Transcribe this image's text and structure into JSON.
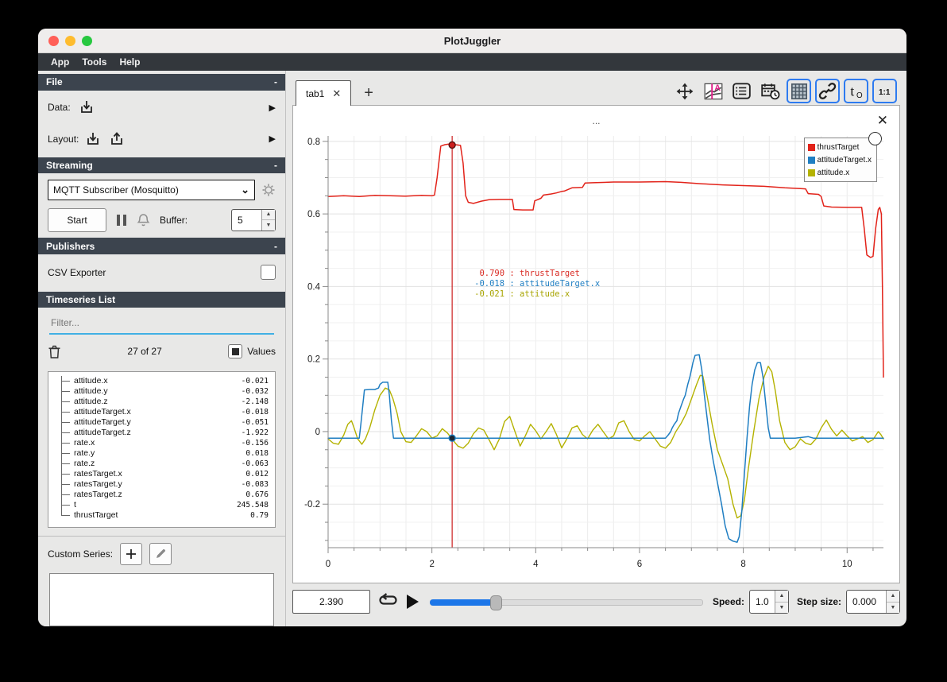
{
  "window": {
    "title": "PlotJuggler"
  },
  "menu": {
    "items": [
      "App",
      "Tools",
      "Help"
    ]
  },
  "sidebar": {
    "file": {
      "header": "File",
      "collapse": "-",
      "data_label": "Data:",
      "layout_label": "Layout:"
    },
    "streaming": {
      "header": "Streaming",
      "collapse": "-",
      "source": "MQTT Subscriber (Mosquitto)",
      "start_label": "Start",
      "buffer_label": "Buffer:",
      "buffer_value": "5"
    },
    "publishers": {
      "header": "Publishers",
      "collapse": "-",
      "csv_exporter_label": "CSV Exporter"
    },
    "timeseries": {
      "header": "Timeseries List",
      "filter_placeholder": "Filter...",
      "count": "27 of 27",
      "values_label": "Values",
      "items": [
        {
          "name": "attitude.x",
          "value": "-0.021"
        },
        {
          "name": "attitude.y",
          "value": "-0.032"
        },
        {
          "name": "attitude.z",
          "value": "-2.148"
        },
        {
          "name": "attitudeTarget.x",
          "value": "-0.018"
        },
        {
          "name": "attitudeTarget.y",
          "value": "-0.051"
        },
        {
          "name": "attitudeTarget.z",
          "value": "-1.922"
        },
        {
          "name": "rate.x",
          "value": "-0.156"
        },
        {
          "name": "rate.y",
          "value": "0.018"
        },
        {
          "name": "rate.z",
          "value": "-0.063"
        },
        {
          "name": "ratesTarget.x",
          "value": "0.012"
        },
        {
          "name": "ratesTarget.y",
          "value": "-0.083"
        },
        {
          "name": "ratesTarget.z",
          "value": "0.676"
        },
        {
          "name": "t",
          "value": "245.548"
        },
        {
          "name": "thrustTarget",
          "value": "0.79"
        }
      ]
    },
    "custom_series": {
      "label": "Custom Series:"
    }
  },
  "main": {
    "tab": {
      "label": "tab1"
    },
    "toolbar": {
      "buttons": [
        {
          "name": "move-icon",
          "active": false
        },
        {
          "name": "axis-font-icon",
          "active": false
        },
        {
          "name": "list-icon",
          "active": false
        },
        {
          "name": "datetime-icon",
          "active": false
        },
        {
          "name": "grid-icon",
          "active": true
        },
        {
          "name": "link-icon",
          "active": true
        },
        {
          "name": "t0-icon",
          "active": true
        },
        {
          "name": "ratio-icon",
          "active": true
        }
      ]
    },
    "plot": {
      "title": "..."
    },
    "playback": {
      "time": "2.390",
      "speed_label": "Speed:",
      "speed": "1.0",
      "step_label": "Step size:",
      "step": "0.000",
      "slider_fraction": 0.23
    }
  },
  "chart_data": {
    "type": "line",
    "title": "...",
    "xlim": [
      0,
      10.7
    ],
    "ylim": [
      -0.32,
      0.815
    ],
    "x_ticks": [
      0,
      2,
      4,
      6,
      8,
      10
    ],
    "y_ticks": [
      -0.2,
      0,
      0.2,
      0.4,
      0.6,
      0.8
    ],
    "x_minor_step": 0.5,
    "y_minor_step": 0.05,
    "grid": true,
    "legend_position": "top-right",
    "tracker": {
      "x": 2.39,
      "color": "#cc1f1f",
      "markers": [
        {
          "series": "thrustTarget",
          "y": 0.79,
          "fill": "#cc1f1f",
          "stroke": "#551111"
        },
        {
          "series": "attitudeTarget.x",
          "y": -0.018,
          "fill": "#1c2733",
          "stroke": "#1f7ec2"
        }
      ]
    },
    "tooltip": {
      "anchor_x": 2.39,
      "anchor_y": 0.45,
      "entries": [
        {
          "value": " 0.790",
          "name": "thrustTarget",
          "color": "#d92b24"
        },
        {
          "value": "-0.018",
          "name": "attitudeTarget.x",
          "color": "#1f7ec2"
        },
        {
          "value": "-0.021",
          "name": "attitude.x",
          "color": "#a8a400"
        }
      ]
    },
    "series": [
      {
        "name": "attitude.x",
        "color": "#b4b200",
        "width": 1.4,
        "points": [
          [
            0,
            -0.02
          ],
          [
            0.1,
            -0.032
          ],
          [
            0.2,
            -0.035
          ],
          [
            0.3,
            -0.01
          ],
          [
            0.38,
            0.02
          ],
          [
            0.45,
            0.03
          ],
          [
            0.5,
            0.01
          ],
          [
            0.57,
            -0.02
          ],
          [
            0.65,
            -0.035
          ],
          [
            0.72,
            -0.02
          ],
          [
            0.8,
            0.01
          ],
          [
            0.9,
            0.06
          ],
          [
            1.0,
            0.1
          ],
          [
            1.1,
            0.12
          ],
          [
            1.18,
            0.115
          ],
          [
            1.25,
            0.09
          ],
          [
            1.33,
            0.05
          ],
          [
            1.4,
            0.0
          ],
          [
            1.5,
            -0.028
          ],
          [
            1.6,
            -0.03
          ],
          [
            1.7,
            -0.012
          ],
          [
            1.8,
            0.008
          ],
          [
            1.9,
            0.0
          ],
          [
            2.0,
            -0.018
          ],
          [
            2.1,
            -0.012
          ],
          [
            2.2,
            0.008
          ],
          [
            2.3,
            -0.004
          ],
          [
            2.39,
            -0.021
          ],
          [
            2.5,
            -0.04
          ],
          [
            2.6,
            -0.046
          ],
          [
            2.7,
            -0.032
          ],
          [
            2.8,
            -0.006
          ],
          [
            2.9,
            0.01
          ],
          [
            3.0,
            0.004
          ],
          [
            3.1,
            -0.022
          ],
          [
            3.2,
            -0.05
          ],
          [
            3.3,
            -0.02
          ],
          [
            3.4,
            0.028
          ],
          [
            3.5,
            0.042
          ],
          [
            3.6,
            0.0
          ],
          [
            3.7,
            -0.04
          ],
          [
            3.8,
            -0.012
          ],
          [
            3.9,
            0.02
          ],
          [
            4.0,
            0.002
          ],
          [
            4.1,
            -0.02
          ],
          [
            4.2,
            0.0
          ],
          [
            4.3,
            0.022
          ],
          [
            4.4,
            -0.008
          ],
          [
            4.5,
            -0.045
          ],
          [
            4.6,
            -0.02
          ],
          [
            4.7,
            0.01
          ],
          [
            4.8,
            0.016
          ],
          [
            4.9,
            -0.008
          ],
          [
            5.0,
            -0.02
          ],
          [
            5.1,
            0.004
          ],
          [
            5.2,
            0.02
          ],
          [
            5.3,
            0.0
          ],
          [
            5.4,
            -0.02
          ],
          [
            5.5,
            -0.012
          ],
          [
            5.6,
            0.024
          ],
          [
            5.7,
            0.03
          ],
          [
            5.8,
            0.0
          ],
          [
            5.9,
            -0.022
          ],
          [
            6.0,
            -0.026
          ],
          [
            6.1,
            -0.012
          ],
          [
            6.2,
            0.0
          ],
          [
            6.3,
            -0.02
          ],
          [
            6.4,
            -0.04
          ],
          [
            6.5,
            -0.046
          ],
          [
            6.6,
            -0.03
          ],
          [
            6.7,
            0.0
          ],
          [
            6.8,
            0.022
          ],
          [
            6.9,
            0.05
          ],
          [
            7.0,
            0.09
          ],
          [
            7.1,
            0.13
          ],
          [
            7.17,
            0.155
          ],
          [
            7.22,
            0.153
          ],
          [
            7.3,
            0.1
          ],
          [
            7.4,
            0.02
          ],
          [
            7.5,
            -0.05
          ],
          [
            7.6,
            -0.09
          ],
          [
            7.7,
            -0.13
          ],
          [
            7.8,
            -0.2
          ],
          [
            7.88,
            -0.238
          ],
          [
            7.95,
            -0.232
          ],
          [
            8.02,
            -0.19
          ],
          [
            8.1,
            -0.1
          ],
          [
            8.2,
            0.0
          ],
          [
            8.3,
            0.09
          ],
          [
            8.4,
            0.15
          ],
          [
            8.48,
            0.18
          ],
          [
            8.55,
            0.165
          ],
          [
            8.62,
            0.11
          ],
          [
            8.7,
            0.03
          ],
          [
            8.8,
            -0.03
          ],
          [
            8.9,
            -0.05
          ],
          [
            9.0,
            -0.042
          ],
          [
            9.1,
            -0.02
          ],
          [
            9.2,
            -0.032
          ],
          [
            9.3,
            -0.036
          ],
          [
            9.4,
            -0.02
          ],
          [
            9.5,
            0.01
          ],
          [
            9.6,
            0.032
          ],
          [
            9.7,
            0.006
          ],
          [
            9.8,
            -0.012
          ],
          [
            9.9,
            0.004
          ],
          [
            10.0,
            -0.012
          ],
          [
            10.1,
            -0.026
          ],
          [
            10.2,
            -0.02
          ],
          [
            10.3,
            -0.014
          ],
          [
            10.4,
            -0.03
          ],
          [
            10.5,
            -0.022
          ],
          [
            10.6,
            0.0
          ],
          [
            10.65,
            -0.008
          ],
          [
            10.7,
            -0.02
          ]
        ]
      },
      {
        "name": "attitudeTarget.x",
        "color": "#1f7ec2",
        "width": 1.5,
        "points": [
          [
            0,
            -0.018
          ],
          [
            0.55,
            -0.018
          ],
          [
            0.6,
            -0.018
          ],
          [
            0.63,
            0.02
          ],
          [
            0.66,
            0.06
          ],
          [
            0.7,
            0.115
          ],
          [
            0.8,
            0.116
          ],
          [
            0.9,
            0.116
          ],
          [
            0.97,
            0.12
          ],
          [
            1.0,
            0.13
          ],
          [
            1.05,
            0.136
          ],
          [
            1.15,
            0.136
          ],
          [
            1.18,
            0.1
          ],
          [
            1.22,
            0.03
          ],
          [
            1.26,
            -0.018
          ],
          [
            2.0,
            -0.018
          ],
          [
            3.0,
            -0.018
          ],
          [
            4.0,
            -0.018
          ],
          [
            5.0,
            -0.018
          ],
          [
            6.0,
            -0.018
          ],
          [
            6.5,
            -0.018
          ],
          [
            6.55,
            -0.01
          ],
          [
            6.6,
            0.0
          ],
          [
            6.63,
            0.01
          ],
          [
            6.67,
            0.02
          ],
          [
            6.72,
            0.03
          ],
          [
            6.75,
            0.05
          ],
          [
            6.8,
            0.07
          ],
          [
            6.85,
            0.09
          ],
          [
            6.88,
            0.1
          ],
          [
            6.93,
            0.13
          ],
          [
            6.97,
            0.15
          ],
          [
            7.0,
            0.17
          ],
          [
            7.03,
            0.19
          ],
          [
            7.07,
            0.21
          ],
          [
            7.15,
            0.212
          ],
          [
            7.2,
            0.17
          ],
          [
            7.25,
            0.1
          ],
          [
            7.3,
            0.04
          ],
          [
            7.35,
            -0.02
          ],
          [
            7.42,
            -0.08
          ],
          [
            7.5,
            -0.14
          ],
          [
            7.58,
            -0.2
          ],
          [
            7.65,
            -0.26
          ],
          [
            7.72,
            -0.295
          ],
          [
            7.8,
            -0.302
          ],
          [
            7.88,
            -0.305
          ],
          [
            7.92,
            -0.29
          ],
          [
            7.97,
            -0.22
          ],
          [
            8.02,
            -0.12
          ],
          [
            8.07,
            -0.02
          ],
          [
            8.12,
            0.07
          ],
          [
            8.17,
            0.13
          ],
          [
            8.22,
            0.17
          ],
          [
            8.27,
            0.19
          ],
          [
            8.33,
            0.19
          ],
          [
            8.38,
            0.15
          ],
          [
            8.43,
            0.08
          ],
          [
            8.48,
            0.01
          ],
          [
            8.52,
            -0.018
          ],
          [
            9.0,
            -0.018
          ],
          [
            9.25,
            -0.014
          ],
          [
            9.35,
            -0.018
          ],
          [
            10.0,
            -0.018
          ],
          [
            10.7,
            -0.018
          ]
        ]
      },
      {
        "name": "thrustTarget",
        "color": "#e2231a",
        "width": 1.5,
        "points": [
          [
            0,
            0.648
          ],
          [
            0.3,
            0.65
          ],
          [
            0.6,
            0.648
          ],
          [
            0.9,
            0.651
          ],
          [
            1.2,
            0.65
          ],
          [
            1.5,
            0.649
          ],
          [
            1.8,
            0.651
          ],
          [
            2.0,
            0.65
          ],
          [
            2.05,
            0.652
          ],
          [
            2.1,
            0.7
          ],
          [
            2.17,
            0.787
          ],
          [
            2.25,
            0.791
          ],
          [
            2.35,
            0.793
          ],
          [
            2.45,
            0.791
          ],
          [
            2.55,
            0.789
          ],
          [
            2.6,
            0.74
          ],
          [
            2.65,
            0.65
          ],
          [
            2.7,
            0.632
          ],
          [
            2.8,
            0.629
          ],
          [
            2.95,
            0.635
          ],
          [
            3.1,
            0.639
          ],
          [
            3.3,
            0.64
          ],
          [
            3.55,
            0.64
          ],
          [
            3.58,
            0.612
          ],
          [
            3.75,
            0.611
          ],
          [
            3.95,
            0.611
          ],
          [
            3.98,
            0.636
          ],
          [
            4.1,
            0.643
          ],
          [
            4.15,
            0.652
          ],
          [
            4.3,
            0.655
          ],
          [
            4.4,
            0.658
          ],
          [
            4.5,
            0.662
          ],
          [
            4.55,
            0.663
          ],
          [
            4.7,
            0.672
          ],
          [
            4.9,
            0.673
          ],
          [
            4.95,
            0.685
          ],
          [
            5.1,
            0.686
          ],
          [
            5.5,
            0.688
          ],
          [
            6.0,
            0.688
          ],
          [
            6.5,
            0.689
          ],
          [
            6.8,
            0.687
          ],
          [
            7.2,
            0.683
          ],
          [
            7.6,
            0.68
          ],
          [
            8.0,
            0.678
          ],
          [
            8.4,
            0.676
          ],
          [
            8.8,
            0.672
          ],
          [
            9.1,
            0.67
          ],
          [
            9.2,
            0.669
          ],
          [
            9.25,
            0.656
          ],
          [
            9.45,
            0.654
          ],
          [
            9.5,
            0.648
          ],
          [
            9.55,
            0.622
          ],
          [
            9.7,
            0.619
          ],
          [
            10.0,
            0.618
          ],
          [
            10.28,
            0.618
          ],
          [
            10.33,
            0.56
          ],
          [
            10.38,
            0.487
          ],
          [
            10.45,
            0.48
          ],
          [
            10.5,
            0.483
          ],
          [
            10.55,
            0.56
          ],
          [
            10.6,
            0.612
          ],
          [
            10.63,
            0.618
          ],
          [
            10.66,
            0.6
          ],
          [
            10.68,
            0.4
          ],
          [
            10.7,
            0.15
          ]
        ]
      }
    ]
  }
}
